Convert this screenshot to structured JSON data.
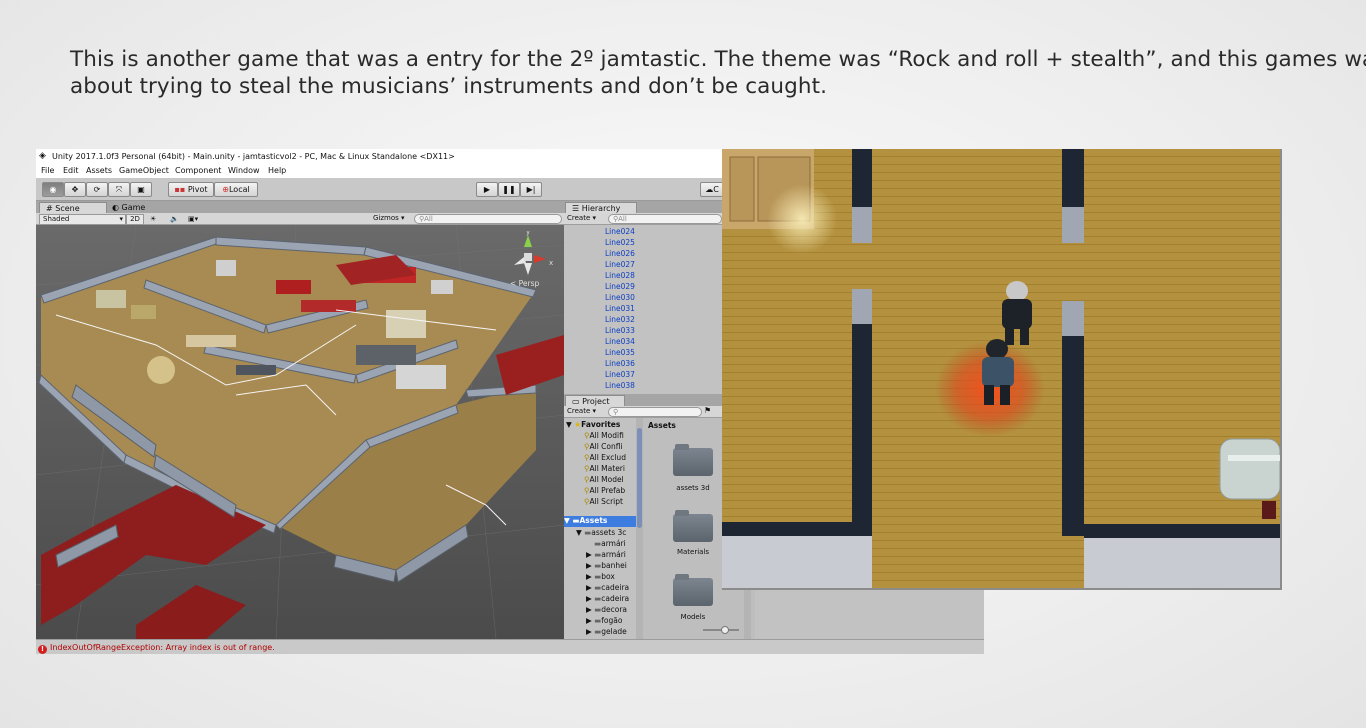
{
  "caption": {
    "line1": "This is another game that was a entry for the 2º jamtastic. The theme was “Rock and roll + stealth”, and this games was",
    "line2": "about trying to steal the musicians’ instruments and don’t be caught."
  },
  "unity": {
    "window_title": "Unity 2017.1.0f3 Personal (64bit) - Main.unity - jamtasticvol2 - PC, Mac & Linux Standalone <DX11>",
    "menu": [
      "File",
      "Edit",
      "Assets",
      "GameObject",
      "Component",
      "Window",
      "Help"
    ],
    "toolbar": {
      "pivot": "Pivot",
      "local": "Local",
      "collab": "C"
    },
    "scene_tabs": {
      "scene": "Scene",
      "game": "Game"
    },
    "scene_bar": {
      "shading": "Shaded",
      "mode_2d": "2D",
      "gizmos": "Gizmos ▾",
      "search_placeholder": "All"
    },
    "gizmo_label": "< Persp",
    "hierarchy": {
      "tab": "Hierarchy",
      "create": "Create ▾",
      "search_placeholder": "All",
      "items": [
        "Line024",
        "Line025",
        "Line026",
        "Line027",
        "Line028",
        "Line029",
        "Line030",
        "Line031",
        "Line032",
        "Line033",
        "Line034",
        "Line035",
        "Line036",
        "Line037",
        "Line038"
      ]
    },
    "project": {
      "tab": "Project",
      "create": "Create ▾",
      "favorites_label": "Favorites",
      "favorites": [
        "All Modifi",
        "All Confli",
        "All Exclud",
        "All Materi",
        "All Model",
        "All Prefab",
        "All Script"
      ],
      "assets_label": "Assets",
      "tree": [
        "assets 3c",
        "armári",
        "armári",
        "banhei",
        "box",
        "cadeira",
        "cadeira",
        "decora",
        "fogão",
        "gelade"
      ],
      "assets_header": "Assets",
      "folders": [
        "assets 3d",
        "Materials",
        "Models"
      ]
    },
    "status": "IndexOutOfRangeException: Array index is out of range."
  }
}
